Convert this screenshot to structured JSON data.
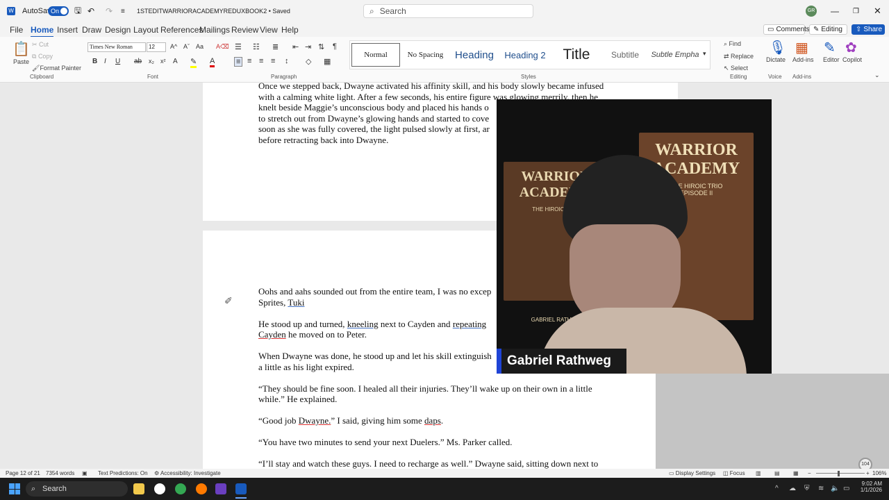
{
  "titlebar": {
    "autosave_label": "AutoSave",
    "autosave_state": "On",
    "doc_title": "1STEDITWARRIORACADEMYREDUXBOOK2 • Saved",
    "search_placeholder": "Search",
    "avatar_initials": "GR"
  },
  "menu": {
    "tabs": [
      "File",
      "Home",
      "Insert",
      "Draw",
      "Design",
      "Layout",
      "References",
      "Mailings",
      "Review",
      "View",
      "Help"
    ],
    "comments": "Comments",
    "editing": "Editing",
    "share": "Share"
  },
  "ribbon": {
    "paste": "Paste",
    "cut": "Cut",
    "copy": "Copy",
    "format_painter": "Format Painter",
    "font_name": "Times New Roman",
    "font_size": "12",
    "groups": {
      "clipboard": "Clipboard",
      "font": "Font",
      "paragraph": "Paragraph",
      "styles": "Styles",
      "editing": "Editing",
      "voice": "Voice",
      "addins": "Add-ins"
    },
    "styles": [
      "Normal",
      "No Spacing",
      "Heading",
      "Heading 2",
      "Title",
      "Subtitle",
      "Subtle Empha"
    ],
    "find": "Find",
    "replace": "Replace",
    "select": "Select",
    "dictate": "Dictate",
    "addins": "Add-ins",
    "editor": "Editor",
    "copilot": "Copilot"
  },
  "document": {
    "page1_lines": [
      "Once we stepped back, Dwayne activated his affinity skill, and his body slowly became infused",
      "with a calming white light. After a few seconds, his entire figure was glowing merrily, then he",
      "knelt beside Maggie’s unconscious body and placed his hands o",
      "to stretch out from Dwayne’s glowing hands and started to cove",
      "soon as she was fully covered, the light pulsed slowly at first, ar",
      "before retracting back into Dwayne."
    ],
    "p1_l1": "Oohs and aahs sounded out from the entire team, I was no excep",
    "p1_l2a": "Sprites, ",
    "p1_l2b": "Tuki",
    "p2_l1a": "He stood up and turned, ",
    "p2_l1b": "kneeling",
    "p2_l1c": " next to Cayden and ",
    "p2_l1d": "repeating",
    "p2_l2a": "Cayden",
    "p2_l2b": " he moved on to Peter.",
    "p3_l1": "When Dwayne was done, he stood up and let his skill extinguish",
    "p3_l2": "a little as his light expired.",
    "p4_l1": "“They should be fine soon.  I healed all their injuries.  They’ll wake up on their own in a little",
    "p4_l2": "while.”  He explained.",
    "p5a": "“Good job ",
    "p5b": "Dwayne.",
    "p5c": "”  I said, giving him some ",
    "p5d": "daps",
    "p5e": ".",
    "p6": "“You have two minutes to send your next Duelers.”  Ms. Parker called.",
    "p7": "“I’ll stay and watch these guys.  I need to recharge as well.”  Dwayne said, sitting down next to"
  },
  "webcam": {
    "name": "Gabriel Rathweg",
    "book_title_1": "WARRIOR",
    "book_title_2": "ACADEMY",
    "book_subtitle_1": "THE HIROIC TRIO",
    "book_subtitle_2": "EPISODE II",
    "book_author": "GABRIEL RATHWE"
  },
  "status": {
    "page": "Page 12 of 21",
    "words": "7354 words",
    "predictions": "Text Predictions: On",
    "accessibility": "Accessibility: Investigate",
    "display": "Display Settings",
    "focus": "Focus",
    "zoom": "106%",
    "badge": "104"
  },
  "taskbar": {
    "search": "Search",
    "time": "9:02 AM",
    "date": "1/1/2026"
  },
  "colors": {
    "accent": "#185abd",
    "spell": "#d33"
  }
}
